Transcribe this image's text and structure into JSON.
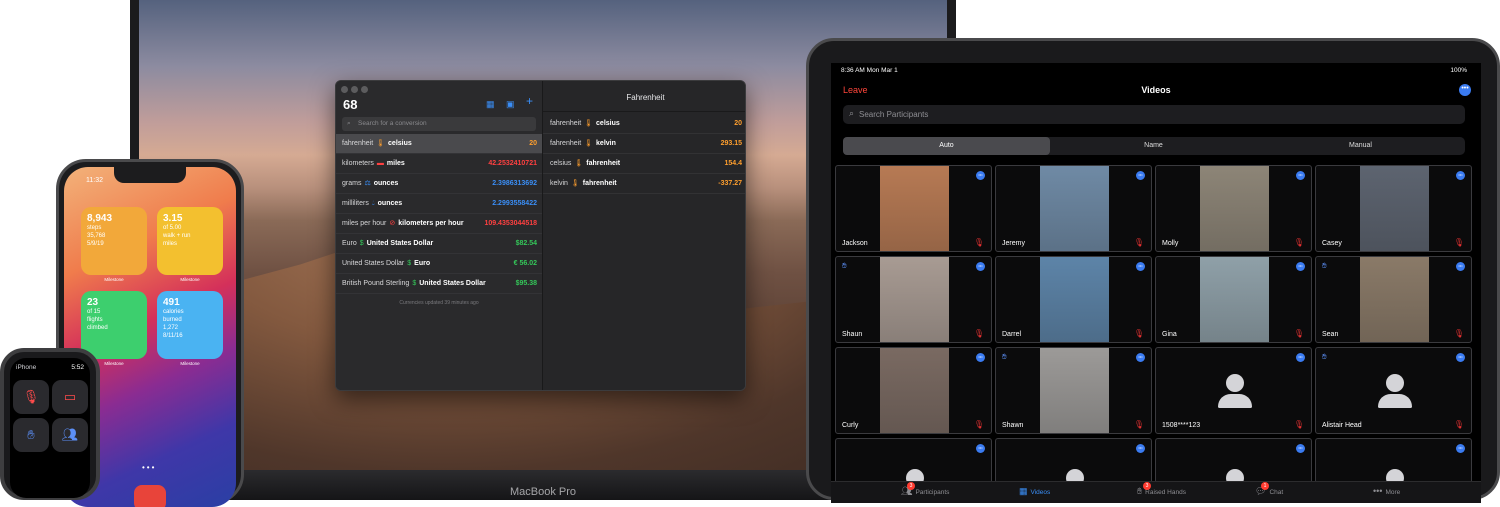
{
  "macbook": {
    "label": "MacBook Pro",
    "app": {
      "count": "68",
      "search_placeholder": "Search for a conversion",
      "conversions": [
        {
          "from": "fahrenheit",
          "to": "celsius",
          "value": "20",
          "color": "#ff9f2e",
          "icon": "thermometer-icon"
        },
        {
          "from": "kilometers",
          "to": "miles",
          "value": "42.2532410721",
          "color": "#ff4040",
          "icon": "ruler-icon"
        },
        {
          "from": "grams",
          "to": "ounces",
          "value": "2.3986313692",
          "color": "#3a8ef6",
          "icon": "scale-icon"
        },
        {
          "from": "milliliters",
          "to": "ounces",
          "value": "2.2993558422",
          "color": "#3a8ef6",
          "icon": "drop-icon"
        },
        {
          "from": "miles per hour",
          "to": "kilometers per hour",
          "value": "109.4353044518",
          "color": "#ff4040",
          "icon": "speedometer-icon"
        },
        {
          "from": "Euro",
          "to": "United States Dollar",
          "value": "$82.54",
          "color": "#34c759",
          "icon": "currency-icon"
        },
        {
          "from": "United States Dollar",
          "to": "Euro",
          "value": "€ 56.02",
          "color": "#34c759",
          "icon": "currency-icon"
        },
        {
          "from": "British Pound Sterling",
          "to": "United States Dollar",
          "value": "$95.38",
          "color": "#34c759",
          "icon": "currency-icon"
        }
      ],
      "footnote": "Currencies updated 39 minutes ago",
      "detail": {
        "title": "Fahrenheit",
        "rows": [
          {
            "from": "fahrenheit",
            "to": "celsius",
            "value": "20"
          },
          {
            "from": "fahrenheit",
            "to": "kelvin",
            "value": "293.15"
          },
          {
            "from": "celsius",
            "to": "fahrenheit",
            "value": "154.4"
          },
          {
            "from": "kelvin",
            "to": "fahrenheit",
            "value": "-337.27"
          }
        ]
      }
    }
  },
  "iphone": {
    "time": "11:32",
    "widgets": [
      {
        "big": "8,943",
        "line1": "steps",
        "line2": "35,768",
        "line3": "5/9/19",
        "color": "#f2a83a",
        "label": "Milestone"
      },
      {
        "big": "3.15",
        "line1": "of 5.00",
        "line2": "walk + run",
        "line3": "miles",
        "color": "#f3c02f",
        "label": "Milestone"
      },
      {
        "big": "23",
        "line1": "of 15",
        "line2": "flights",
        "line3": "climbed",
        "color": "#3dcf6e",
        "label": "Milestone"
      },
      {
        "big": "491",
        "line1": "calories",
        "line2": "burned",
        "line3": "1,272",
        "line4": "8/11/16",
        "color": "#4ab3f2",
        "label": "Milestone"
      }
    ]
  },
  "watch": {
    "title": "iPhone",
    "time": "5:52"
  },
  "ipad": {
    "status_time": "8:36 AM  Mon Mar 1",
    "battery": "100%",
    "leave": "Leave",
    "title": "Videos",
    "search_placeholder": "Search Participants",
    "segments": [
      "Auto",
      "Name",
      "Manual"
    ],
    "participants": [
      {
        "name": "Jackson",
        "photo": "#b77a54"
      },
      {
        "name": "Jeremy",
        "photo": "#6f8aa5"
      },
      {
        "name": "Molly",
        "photo": "#8d8577"
      },
      {
        "name": "Casey",
        "photo": "#5d6470"
      },
      {
        "name": "Shaun",
        "photo": "#a89b93"
      },
      {
        "name": "Darrel",
        "photo": "#5d84a8"
      },
      {
        "name": "Gina",
        "photo": "#8fa0a8"
      },
      {
        "name": "Sean",
        "photo": "#8a7a68"
      },
      {
        "name": "Curly",
        "photo": "#7a6a62"
      },
      {
        "name": "Shawn",
        "photo": "#9c9a98"
      },
      {
        "name": "1508****123",
        "photo": ""
      },
      {
        "name": "Alistair Head",
        "photo": ""
      }
    ],
    "tabs": [
      {
        "label": "Participants",
        "badge": "3"
      },
      {
        "label": "Videos",
        "badge": ""
      },
      {
        "label": "Raised Hands",
        "badge": "3"
      },
      {
        "label": "Chat",
        "badge": "1"
      },
      {
        "label": "More",
        "badge": ""
      }
    ]
  }
}
